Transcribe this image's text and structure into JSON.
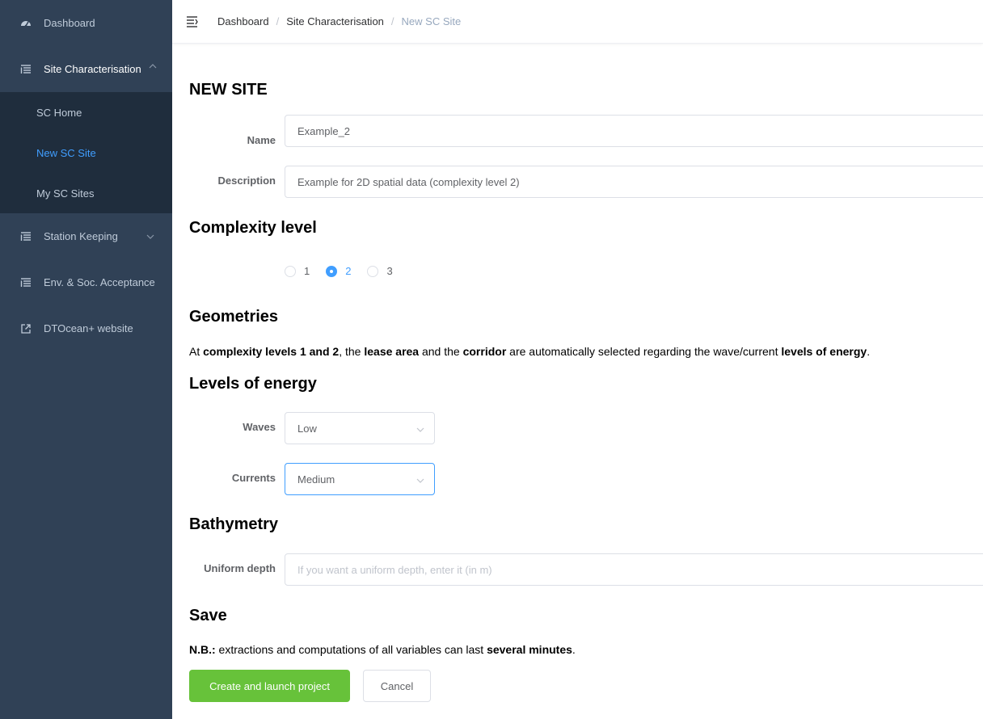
{
  "sidebar": {
    "dashboard": "Dashboard",
    "site_characterisation": "Site Characterisation",
    "sc_home": "SC Home",
    "new_sc_site": "New SC Site",
    "my_sc_sites": "My SC Sites",
    "station_keeping": "Station Keeping",
    "env_soc": "Env. & Soc. Acceptance",
    "website": "DTOcean+ website"
  },
  "breadcrumb": {
    "item1": "Dashboard",
    "item2": "Site Characterisation",
    "item3": "New SC Site",
    "sep": "/"
  },
  "form": {
    "title": "NEW SITE",
    "name_label": "Name",
    "name_value": "Example_2",
    "description_label": "Description",
    "description_value": "Example for 2D spatial data (complexity level 2)",
    "complexity_title": "Complexity level",
    "complexity_options": [
      "1",
      "2",
      "3"
    ],
    "complexity_selected": "2",
    "geometries_title": "Geometries",
    "geom_text": {
      "p1": "At ",
      "b1": "complexity levels 1 and 2",
      "p2": ", the ",
      "b2": "lease area",
      "p3": " and the ",
      "b3": "corridor",
      "p4": " are automatically selected regarding the wave/current ",
      "b4": "levels of energy",
      "p5": "."
    },
    "energy_title": "Levels of energy",
    "waves_label": "Waves",
    "waves_value": "Low",
    "currents_label": "Currents",
    "currents_value": "Medium",
    "bathymetry_title": "Bathymetry",
    "depth_label": "Uniform depth",
    "depth_placeholder": "If you want a uniform depth, enter it (in m)",
    "save_title": "Save",
    "nb": {
      "b1": "N.B.:",
      "p1": " extractions and computations of all variables can last ",
      "b2": "several minutes",
      "p2": "."
    },
    "create_button": "Create and launch project",
    "cancel_button": "Cancel"
  },
  "colors": {
    "sidebar_bg": "#304156",
    "submenu_bg": "#1f2d3d",
    "accent": "#409eff",
    "success": "#67c23a"
  }
}
